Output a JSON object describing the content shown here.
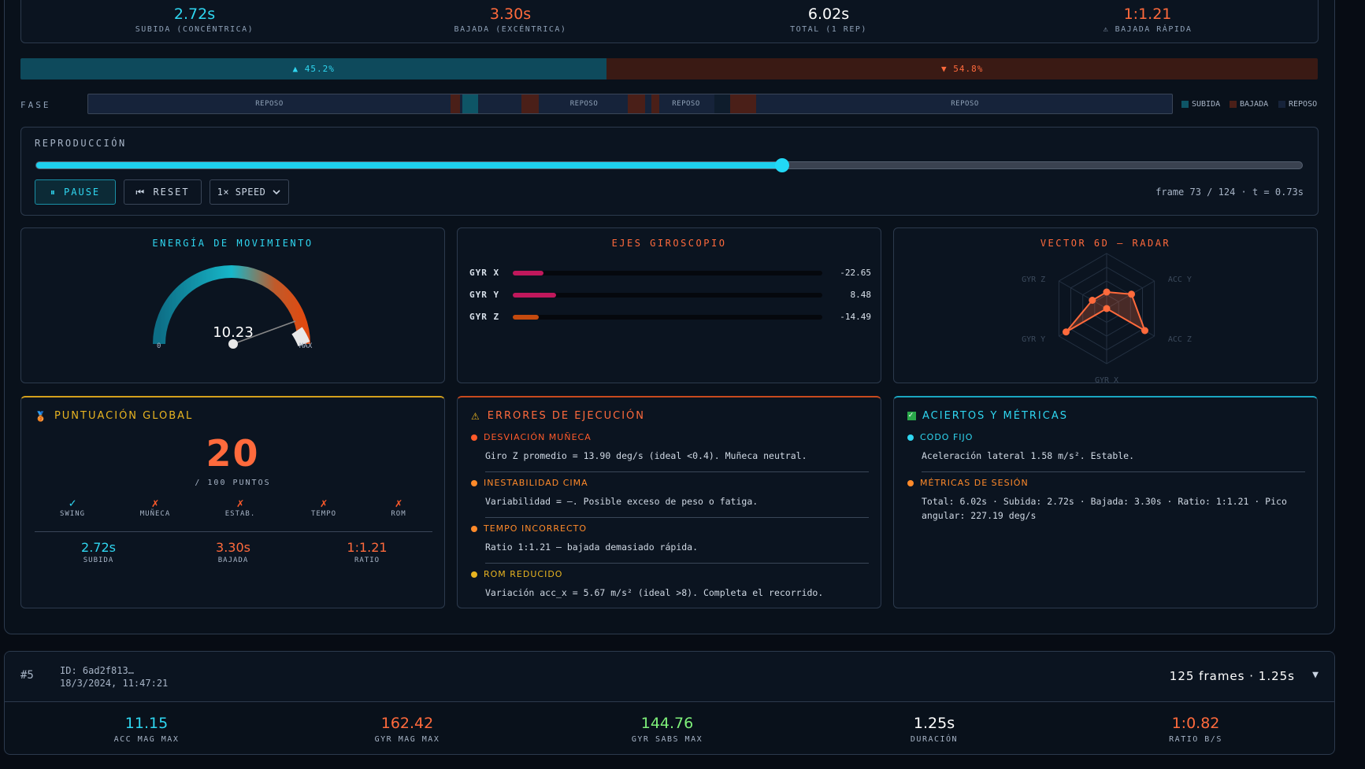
{
  "top_stats": [
    {
      "value": "2.72s",
      "label": "SUBIDA (CONCÉNTRICA)",
      "color": "#2fd6f0"
    },
    {
      "value": "3.30s",
      "label": "BAJADA (EXCÉNTRICA)",
      "color": "#ff6a3c"
    },
    {
      "value": "6.02s",
      "label": "TOTAL (1 REP)",
      "color": "#ffffff"
    },
    {
      "value": "1:1.21",
      "label": "⚠ BAJADA RÁPIDA",
      "color": "#ff6a3c"
    }
  ],
  "ratio": {
    "up_label": "▲ 45.2%",
    "down_label": "▼ 54.8%",
    "up_fraction": 0.452
  },
  "phase": {
    "label": "FASE",
    "segments": [
      "REPOSO",
      "REPOSO",
      "REPOSO",
      "REPOSO"
    ],
    "legend": {
      "up": "SUBIDA",
      "down": "BAJADA",
      "rest": "REPOSO"
    }
  },
  "playback": {
    "title": "REPRODUCCIÓN",
    "progress": 0.589,
    "pause_label": "⏸ PAUSE",
    "reset_label": "⏮ RESET",
    "speed_label": "1× SPEED",
    "frame_info": "frame 73 / 124 · t = 0.73s"
  },
  "energy": {
    "title": "ENERGÍA DE MOVIMIENTO",
    "value": "10.23",
    "min_label": "0",
    "max_label": "MAX",
    "level": 1.0
  },
  "gyro": {
    "title": "EJES GIROSCOPIO",
    "axes": [
      {
        "name": "GYR X",
        "value": "-22.65",
        "fraction": 0.1,
        "color": "#c0185c"
      },
      {
        "name": "GYR Y",
        "value": "8.48",
        "fraction": 0.14,
        "color": "#c0185c"
      },
      {
        "name": "GYR Z",
        "value": "-14.49",
        "fraction": 0.085,
        "color": "#c44a0e"
      }
    ]
  },
  "radar": {
    "title": "VECTOR 6D — RADAR",
    "axes": [
      "GYR Z",
      "ACC Y",
      "ACC Z",
      "GYR X",
      "GYR Y"
    ],
    "values": [
      0.3,
      0.52,
      0.8,
      0.0,
      0.85,
      0.3
    ]
  },
  "score": {
    "title": "PUNTUACIÓN GLOBAL",
    "value": "20",
    "unit": "/ 100 PUNTOS",
    "criteria": [
      {
        "mark": "✓",
        "label": "SWING",
        "ok": true
      },
      {
        "mark": "✗",
        "label": "MUÑECA",
        "ok": false
      },
      {
        "mark": "✗",
        "label": "ESTAB.",
        "ok": false
      },
      {
        "mark": "✗",
        "label": "TEMPO",
        "ok": false
      },
      {
        "mark": "✗",
        "label": "ROM",
        "ok": false
      }
    ],
    "mini": [
      {
        "value": "2.72s",
        "label": "SUBIDA",
        "color": "#2fd6f0"
      },
      {
        "value": "3.30s",
        "label": "BAJADA",
        "color": "#ff6a3c"
      },
      {
        "value": "1:1.21",
        "label": "RATIO",
        "color": "#ff6a3c"
      }
    ]
  },
  "errors": {
    "title": "ERRORES DE EJECUCIÓN",
    "items": [
      {
        "head": "DESVIACIÓN MUÑECA",
        "text": "Giro Z promedio = 13.90 deg/s (ideal <0.4). Muñeca neutral.",
        "color": "#ff5a2a"
      },
      {
        "head": "INESTABILIDAD CIMA",
        "text": "Variabilidad = —. Posible exceso de peso o fatiga.",
        "color": "#ff8a2a"
      },
      {
        "head": "TEMPO INCORRECTO",
        "text": "Ratio 1:1.21 — bajada demasiado rápida.",
        "color": "#ff8a2a"
      },
      {
        "head": "ROM REDUCIDO",
        "text": "Variación acc_x = 5.67 m/s² (ideal >8). Completa el recorrido.",
        "color": "#e8b420"
      }
    ]
  },
  "successes": {
    "title": "ACIERTOS Y MÉTRICAS",
    "items": [
      {
        "head": "CODO FIJO",
        "text": "Aceleración lateral 1.58 m/s². Estable.",
        "color": "#2fd6f0"
      },
      {
        "head": "MÉTRICAS DE SESIÓN",
        "text": "Total: 6.02s · Subida: 2.72s · Bajada: 3.30s · Ratio: 1:1.21 · Pico angular: 227.19 deg/s",
        "color": "#ff8a2a"
      }
    ]
  },
  "session": {
    "number": "#5",
    "id": "ID: 6ad2f813…",
    "date": "18/3/2024, 11:47:21",
    "summary": "125 frames · 1.25s",
    "metrics": [
      {
        "value": "11.15",
        "label": "ACC MAG MAX",
        "color": "#2fd6f0"
      },
      {
        "value": "162.42",
        "label": "GYR MAG MAX",
        "color": "#ff6a3c"
      },
      {
        "value": "144.76",
        "label": "GYR SABS MAX",
        "color": "#7ef07a"
      },
      {
        "value": "1.25s",
        "label": "DURACIÓN",
        "color": "#ffffff"
      },
      {
        "value": "1:0.82",
        "label": "RATIO B/S",
        "color": "#ff6a3c"
      }
    ]
  }
}
